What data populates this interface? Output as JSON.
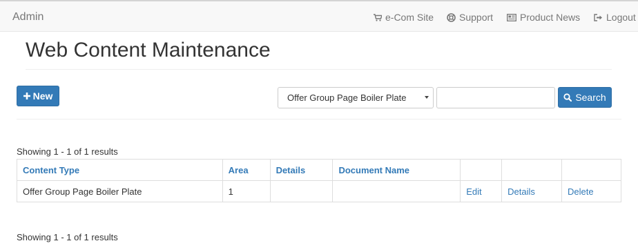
{
  "navbar": {
    "brand": "Admin",
    "links": [
      {
        "label": "e-Com Site",
        "icon": "cart-icon"
      },
      {
        "label": "Support",
        "icon": "lifebuoy-icon"
      },
      {
        "label": "Product News",
        "icon": "newspaper-icon"
      },
      {
        "label": "Logout",
        "icon": "logout-icon"
      }
    ]
  },
  "page": {
    "title": "Web Content Maintenance"
  },
  "toolbar": {
    "new_label": "New",
    "new_icon": "plus-icon",
    "filter_selected": "Offer Group Page Boiler Plate",
    "search_value": "",
    "search_label": "Search",
    "search_icon": "search-icon",
    "primary_color": "#337ab7"
  },
  "results_summary": {
    "top": "Showing 1 - 1 of 1 results",
    "bottom": "Showing 1 - 1 of 1 results"
  },
  "table": {
    "headers": [
      "Content Type",
      "Area",
      "Details",
      "Document Name",
      "",
      "",
      ""
    ],
    "rows": [
      {
        "content_type": "Offer Group Page Boiler Plate",
        "area": "1",
        "details": "",
        "document_name": "",
        "edit_label": "Edit",
        "details_label": "Details",
        "delete_label": "Delete"
      }
    ]
  }
}
